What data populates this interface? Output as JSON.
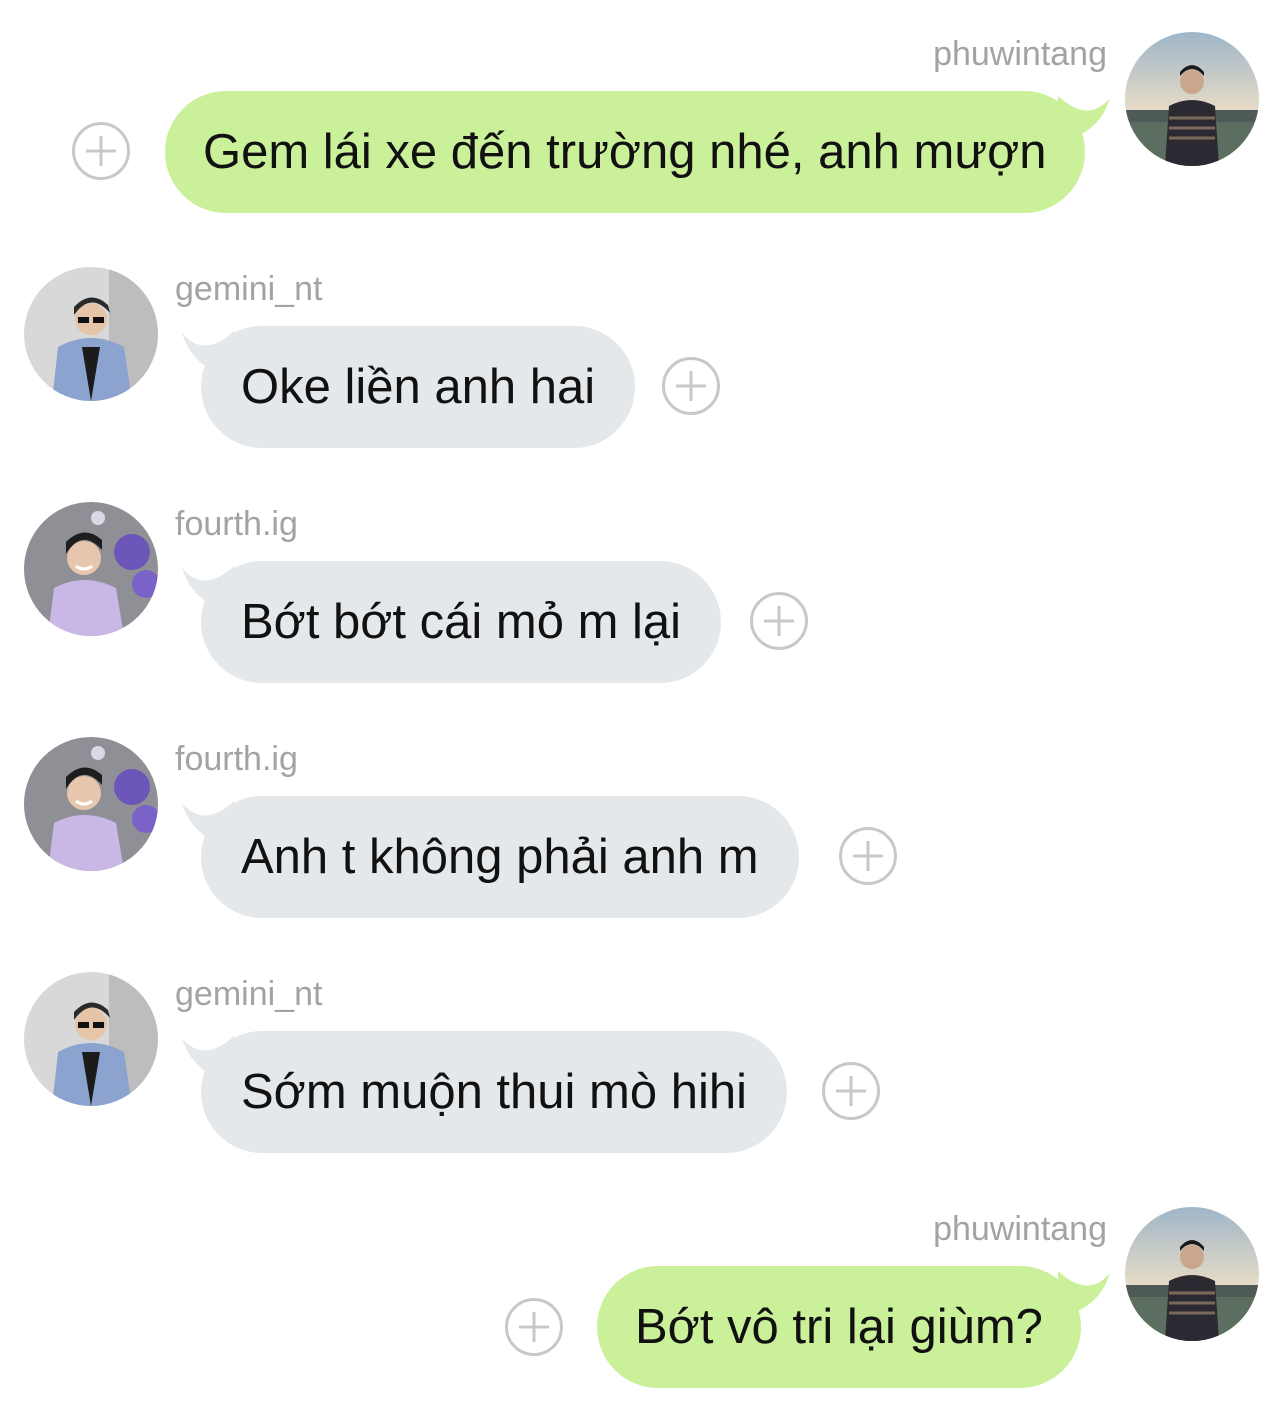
{
  "messages": [
    {
      "sender": "phuwintang",
      "text": "Gem lái xe đến trường nhé, anh mượn"
    },
    {
      "sender": "gemini_nt",
      "text": "Oke liền anh hai"
    },
    {
      "sender": "fourth.ig",
      "text": "Bớt bớt cái mỏ m lại"
    },
    {
      "sender": "fourth.ig",
      "text": "Anh t không phải anh m"
    },
    {
      "sender": "gemini_nt",
      "text": "Sớm muộn thui mò hihi"
    },
    {
      "sender": "phuwintang",
      "text": "Bớt vô tri lại giùm?"
    }
  ],
  "colors": {
    "outgoing_bubble": "#cbf09a",
    "incoming_bubble": "#e5e8eb",
    "username": "#a3a3a3",
    "react_icon": "#c8c8c8"
  },
  "icons": {
    "react": "add-reaction-icon",
    "avatar": "avatar-photo"
  }
}
